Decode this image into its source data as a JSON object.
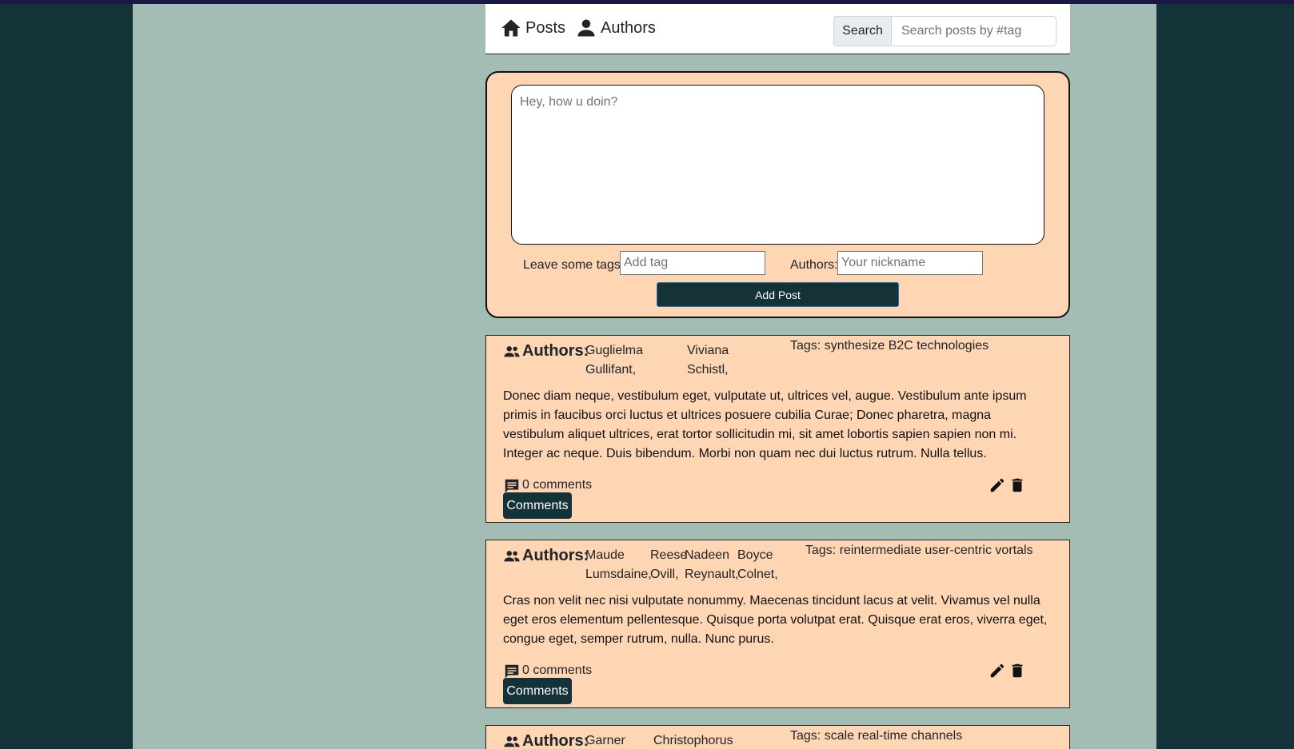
{
  "navbar": {
    "posts_label": "Posts",
    "authors_label": "Authors",
    "search_label": "Search",
    "search_placeholder": "Search posts by #tag"
  },
  "composer": {
    "textarea_placeholder": "Hey, how u doin?",
    "tags_label": "Leave some tags:",
    "tags_placeholder": "Add tag",
    "authors_label": "Authors:",
    "authors_placeholder": "Your nickname",
    "submit_label": "Add Post"
  },
  "posts": [
    {
      "authors_title": "Authors:",
      "authors": [
        {
          "first": "Guglielma",
          "last": "Gullifant,"
        },
        {
          "first": "Viviana",
          "last": "Schistl,"
        }
      ],
      "tags": "Tags: synthesize B2C technologies",
      "body": "Donec diam neque, vestibulum eget, vulputate ut, ultrices vel, augue. Vestibulum ante ipsum primis in faucibus orci luctus et ultrices posuere cubilia Curae; Donec pharetra, magna vestibulum aliquet ultrices, erat tortor sollicitudin mi, sit amet lobortis sapien sapien non mi. Integer ac neque. Duis bibendum. Morbi non quam nec dui luctus rutrum. Nulla tellus.",
      "comment_count": "0 comments",
      "comments_button": "Comments"
    },
    {
      "authors_title": "Authors:",
      "authors": [
        {
          "first": "Maude",
          "last": "Lumsdaine,"
        },
        {
          "first": "Reese",
          "last": "Ovill,"
        },
        {
          "first": "Nadeen",
          "last": "Reynault,"
        },
        {
          "first": "Boyce",
          "last": "Colnet,"
        }
      ],
      "tags": "Tags: reintermediate user-centric vortals",
      "body": "Cras non velit nec nisi vulputate nonummy. Maecenas tincidunt lacus at velit. Vivamus vel nulla eget eros elementum pellentesque. Quisque porta volutpat erat. Quisque erat eros, viverra eget, congue eget, semper rutrum, nulla. Nunc purus.",
      "comment_count": "0 comments",
      "comments_button": "Comments"
    },
    {
      "authors_title": "Authors:",
      "authors": [
        {
          "first": "Garner",
          "last": ""
        },
        {
          "first": "Christophorus",
          "last": ""
        }
      ],
      "tags": "Tags: scale real-time channels"
    }
  ],
  "icons": {
    "home": "home-icon",
    "person": "person-icon",
    "group": "group-icon",
    "comment": "comment-icon",
    "edit": "pencil-icon",
    "delete": "trash-icon"
  },
  "colors": {
    "page_bg": "#143339",
    "content_bg": "#a3bdb5",
    "card_bg": "#fed6b4",
    "button_bg": "#143339"
  }
}
